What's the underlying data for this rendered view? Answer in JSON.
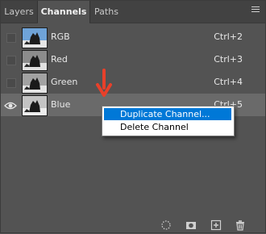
{
  "tabs": [
    {
      "label": "Layers"
    },
    {
      "label": "Channels"
    },
    {
      "label": "Paths"
    }
  ],
  "channels": [
    {
      "label": "RGB",
      "shortcut": "Ctrl+2",
      "visible": false
    },
    {
      "label": "Red",
      "shortcut": "Ctrl+3",
      "visible": false
    },
    {
      "label": "Green",
      "shortcut": "Ctrl+4",
      "visible": false
    },
    {
      "label": "Blue",
      "shortcut": "Ctrl+5",
      "visible": true,
      "selected": true
    }
  ],
  "context_menu": {
    "items": [
      {
        "label": "Duplicate Channel..."
      },
      {
        "label": "Delete Channel"
      }
    ]
  },
  "bottom_icons": [
    "load-selection-icon",
    "save-selection-icon",
    "new-channel-icon",
    "trash-icon"
  ],
  "colors": {
    "panel_bg": "#535353",
    "tab_bar_bg": "#424242",
    "selected_row": "#6a6a6a",
    "menu_highlight": "#0078d7",
    "annotation_arrow": "#e8402a"
  }
}
